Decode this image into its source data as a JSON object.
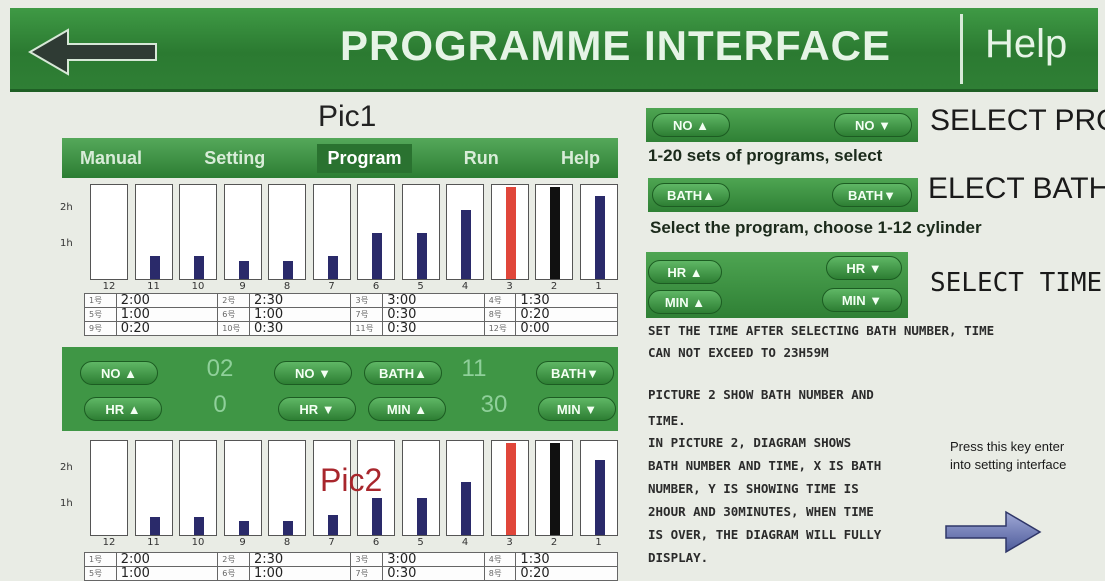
{
  "header": {
    "title": "PROGRAMME INTERFACE",
    "help": "Help"
  },
  "pic1": {
    "title": "Pic1",
    "tabs": [
      {
        "label": "Manual",
        "active": false
      },
      {
        "label": "Setting",
        "active": false
      },
      {
        "label": "Program",
        "active": true
      },
      {
        "label": "Run",
        "active": false
      },
      {
        "label": "Help",
        "active": false
      }
    ],
    "y_ticks": [
      "2h",
      "1h"
    ],
    "columns": [
      {
        "num": "12",
        "level": 0.0,
        "kind": "normal"
      },
      {
        "num": "11",
        "level": 0.25,
        "kind": "normal"
      },
      {
        "num": "10",
        "level": 0.25,
        "kind": "normal"
      },
      {
        "num": "9",
        "level": 0.2,
        "kind": "normal"
      },
      {
        "num": "8",
        "level": 0.2,
        "kind": "normal"
      },
      {
        "num": "7",
        "level": 0.25,
        "kind": "normal"
      },
      {
        "num": "6",
        "level": 0.5,
        "kind": "normal"
      },
      {
        "num": "5",
        "level": 0.5,
        "kind": "normal"
      },
      {
        "num": "4",
        "level": 0.75,
        "kind": "normal"
      },
      {
        "num": "3",
        "level": 1.0,
        "kind": "red"
      },
      {
        "num": "2",
        "level": 1.0,
        "kind": "black"
      },
      {
        "num": "1",
        "level": 0.9,
        "kind": "normal"
      }
    ],
    "table": [
      [
        {
          "label": "1号",
          "value": "2:00"
        },
        {
          "label": "2号",
          "value": "2:30"
        },
        {
          "label": "3号",
          "value": "3:00"
        },
        {
          "label": "4号",
          "value": "1:30"
        }
      ],
      [
        {
          "label": "5号",
          "value": "1:00"
        },
        {
          "label": "6号",
          "value": "1:00"
        },
        {
          "label": "7号",
          "value": "0:30"
        },
        {
          "label": "8号",
          "value": "0:20"
        }
      ],
      [
        {
          "label": "9号",
          "value": "0:20"
        },
        {
          "label": "10号",
          "value": "0:30"
        },
        {
          "label": "11号",
          "value": "0:30"
        },
        {
          "label": "12号",
          "value": "0:00"
        }
      ]
    ],
    "controls": {
      "no_up": "NO ▲",
      "no_value": "02",
      "no_down": "NO ▼",
      "bath_up": "BATH▲",
      "bath_value": "11",
      "bath_down": "BATH▼",
      "hr_up": "HR ▲",
      "hr_value": "0",
      "hr_down": "HR ▼",
      "min_up": "MIN ▲",
      "min_value": "30",
      "min_down": "MIN ▼"
    }
  },
  "pic2": {
    "title": "Pic2",
    "columns": [
      {
        "num": "12",
        "level": 0.0,
        "kind": "normal"
      },
      {
        "num": "11",
        "level": 0.2,
        "kind": "normal"
      },
      {
        "num": "10",
        "level": 0.2,
        "kind": "normal"
      },
      {
        "num": "9",
        "level": 0.15,
        "kind": "normal"
      },
      {
        "num": "8",
        "level": 0.15,
        "kind": "normal"
      },
      {
        "num": "7",
        "level": 0.22,
        "kind": "normal"
      },
      {
        "num": "6",
        "level": 0.4,
        "kind": "normal"
      },
      {
        "num": "5",
        "level": 0.4,
        "kind": "normal"
      },
      {
        "num": "4",
        "level": 0.58,
        "kind": "normal"
      },
      {
        "num": "3",
        "level": 1.0,
        "kind": "red"
      },
      {
        "num": "2",
        "level": 1.0,
        "kind": "black"
      },
      {
        "num": "1",
        "level": 0.82,
        "kind": "normal"
      }
    ],
    "table": [
      [
        {
          "label": "1号",
          "value": "2:00"
        },
        {
          "label": "2号",
          "value": "2:30"
        },
        {
          "label": "3号",
          "value": "3:00"
        },
        {
          "label": "4号",
          "value": "1:30"
        }
      ],
      [
        {
          "label": "5号",
          "value": "1:00"
        },
        {
          "label": "6号",
          "value": "1:00"
        },
        {
          "label": "7号",
          "value": "0:30"
        },
        {
          "label": "8号",
          "value": "0:20"
        }
      ]
    ]
  },
  "right": {
    "select_prog": {
      "up": "NO ▲",
      "down": "NO ▼",
      "label": "SELECT PROG",
      "desc": "1-20 sets of programs, select"
    },
    "select_bath": {
      "up": "BATH▲",
      "down": "BATH▼",
      "label": "ELECT BATH",
      "desc": "Select the program, choose 1-12 cylinder"
    },
    "select_time": {
      "hr_up": "HR ▲",
      "hr_down": "HR ▼",
      "min_up": "MIN ▲",
      "min_down": "MIN ▼",
      "label": "SELECT TIME"
    },
    "set_time_lines": [
      "SET THE TIME AFTER SELECTING BATH NUMBER, TIME",
      "CAN NOT EXCEED TO 23H59M"
    ],
    "pic2_lines": [
      "PICTURE 2 SHOW BATH NUMBER AND",
      "TIME.",
      "IN PICTURE 2, DIAGRAM SHOWS",
      "BATH NUMBER AND TIME, X IS BATH",
      "NUMBER, Y IS SHOWING TIME IS",
      "2HOUR AND 30MINUTES, WHEN TIME",
      "IS OVER, THE DIAGRAM WILL FULLY",
      "DISPLAY."
    ],
    "press_note": "Press this key enter into setting interface"
  },
  "icons": {
    "back": "back-arrow-icon",
    "next": "next-arrow-icon"
  },
  "colors": {
    "header_green": "#2b7a31",
    "button_green": "#3f9645",
    "marker_red": "#e0463a"
  }
}
